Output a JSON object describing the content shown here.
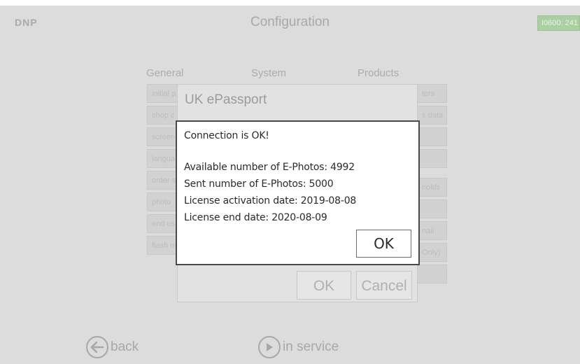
{
  "header": {
    "logo": "DNP",
    "title": "Configuration",
    "device_id": "I0600: 241"
  },
  "columns": {
    "general": "General",
    "system": "System",
    "products": "Products"
  },
  "background_buttons": {
    "left": [
      "initial p",
      "shop c",
      "screen",
      "langua",
      "order s",
      "photo",
      "end us",
      "flash m"
    ],
    "right": [
      "ters",
      "s data",
      "",
      "",
      "holds",
      "",
      "nail",
      "Only)",
      ""
    ]
  },
  "bottom_nav": {
    "back_label": "back",
    "service_label": "in service"
  },
  "dialog": {
    "title": "UK ePassport",
    "ok_label": "OK",
    "cancel_label": "Cancel"
  },
  "message": {
    "status": "Connection is OK!",
    "lines": [
      "Available number of E-Photos: 4992",
      "Sent number of E-Photos: 5000",
      "License activation date: 2019-08-08",
      "License end date: 2020-08-09"
    ],
    "ok_label": "OK"
  }
}
